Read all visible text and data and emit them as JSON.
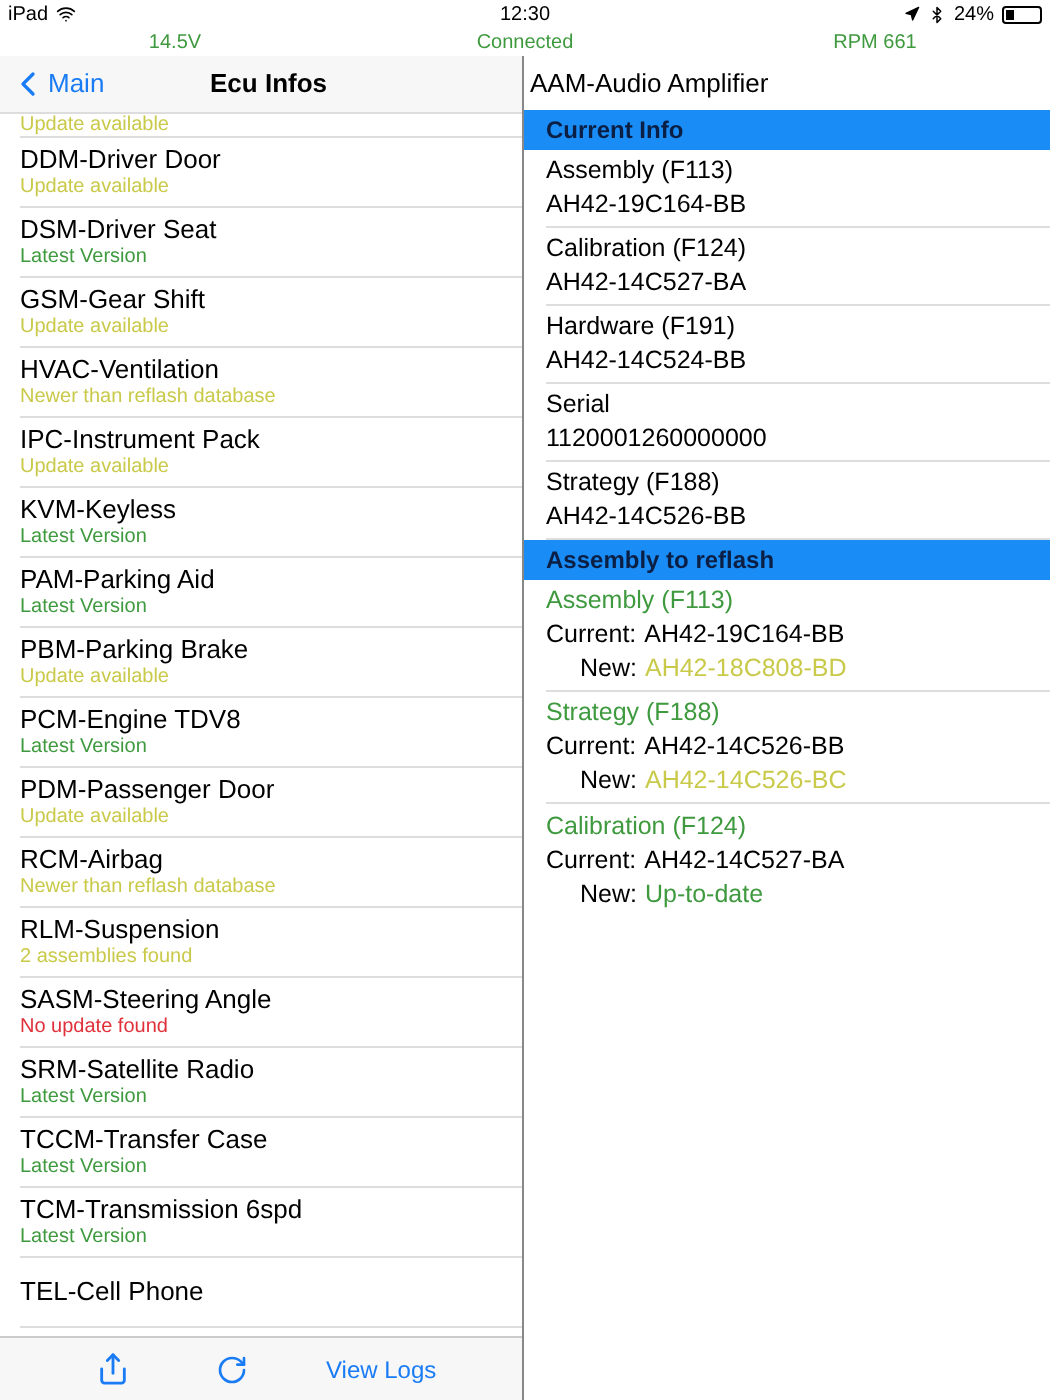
{
  "status_bar": {
    "device": "iPad",
    "time": "12:30",
    "battery": "24%"
  },
  "info_bar": {
    "voltage": "14.5V",
    "connection": "Connected",
    "rpm": "RPM 661"
  },
  "nav": {
    "back": "Main",
    "title": "Ecu Infos"
  },
  "ecu_list": [
    {
      "status": "Update available",
      "color": "#c9c94a"
    },
    {
      "name": "DDM-Driver Door",
      "status": "Update available",
      "color": "#c9c94a"
    },
    {
      "name": "DSM-Driver Seat",
      "status": "Latest Version",
      "color": "#3f9a3f"
    },
    {
      "name": "GSM-Gear Shift",
      "status": "Update available",
      "color": "#c9c94a"
    },
    {
      "name": "HVAC-Ventilation",
      "status": "Newer than reflash database",
      "color": "#c9c94a"
    },
    {
      "name": "IPC-Instrument Pack",
      "status": "Update available",
      "color": "#c9c94a"
    },
    {
      "name": "KVM-Keyless",
      "status": "Latest Version",
      "color": "#3f9a3f"
    },
    {
      "name": "PAM-Parking Aid",
      "status": "Latest Version",
      "color": "#3f9a3f"
    },
    {
      "name": "PBM-Parking Brake",
      "status": "Update available",
      "color": "#c9c94a"
    },
    {
      "name": "PCM-Engine TDV8",
      "status": "Latest Version",
      "color": "#3f9a3f"
    },
    {
      "name": "PDM-Passenger Door",
      "status": "Update available",
      "color": "#c9c94a"
    },
    {
      "name": "RCM-Airbag",
      "status": "Newer than reflash database",
      "color": "#c9c94a"
    },
    {
      "name": "RLM-Suspension",
      "status": "2 assemblies found",
      "color": "#c9c94a"
    },
    {
      "name": "SASM-Steering Angle",
      "status": "No update found",
      "color": "#e0303a"
    },
    {
      "name": "SRM-Satellite Radio",
      "status": "Latest Version",
      "color": "#3f9a3f"
    },
    {
      "name": "TCCM-Transfer Case",
      "status": "Latest Version",
      "color": "#3f9a3f"
    },
    {
      "name": "TCM-Transmission 6spd",
      "status": "Latest Version",
      "color": "#3f9a3f"
    },
    {
      "name": "TEL-Cell Phone"
    }
  ],
  "toolbar": {
    "view_logs": "View Logs"
  },
  "detail": {
    "title": "AAM-Audio Amplifier",
    "current_header": "Current Info",
    "current_info": [
      {
        "label": "Assembly (F113)",
        "value": "AH42-19C164-BB"
      },
      {
        "label": "Calibration (F124)",
        "value": "AH42-14C527-BA"
      },
      {
        "label": "Hardware (F191)",
        "value": "AH42-14C524-BB"
      },
      {
        "label": "Serial",
        "value": "1120001260000000"
      },
      {
        "label": "Strategy (F188)",
        "value": "AH42-14C526-BB"
      }
    ],
    "reflash_header": "Assembly to reflash",
    "reflash": [
      {
        "label": "Assembly (F113)",
        "current_label": "Current:",
        "current": "AH42-19C164-BB",
        "new_label": "New:",
        "new": "AH42-18C808-BD",
        "color": "#c9c94a"
      },
      {
        "label": "Strategy (F188)",
        "current_label": "Current:",
        "current": "AH42-14C526-BB",
        "new_label": "New:",
        "new": "AH42-14C526-BC",
        "color": "#c9c94a"
      },
      {
        "label": "Calibration (F124)",
        "current_label": "Current:",
        "current": "AH42-14C527-BA",
        "new_label": "New:",
        "new": "Up-to-date",
        "color": "#3f9a3f"
      }
    ]
  }
}
